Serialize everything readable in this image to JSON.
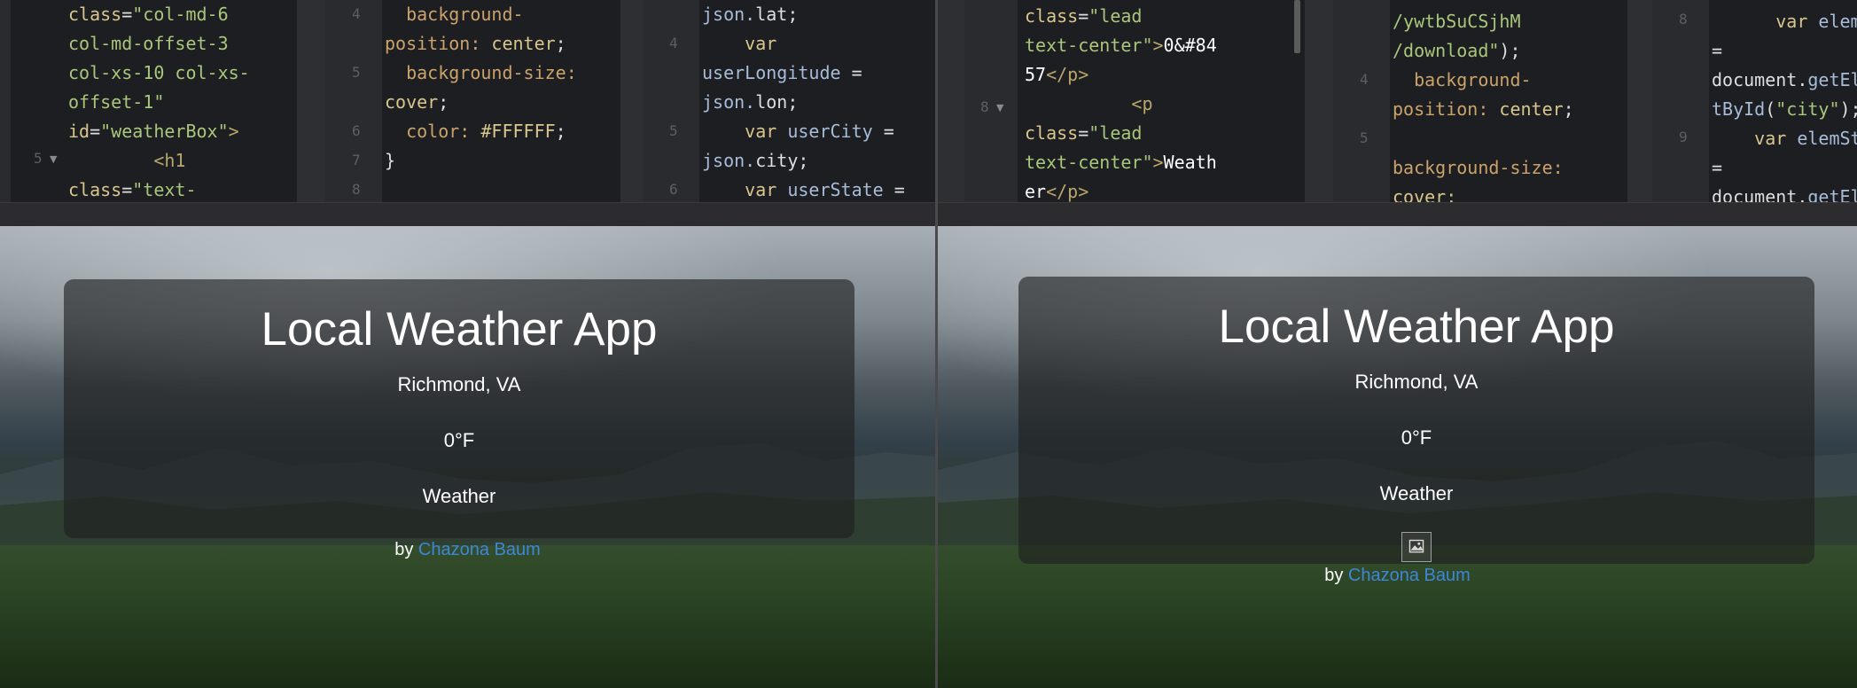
{
  "left": {
    "html_lines": [
      [
        {
          "t": "class",
          "c": "at"
        },
        {
          "t": "=",
          "c": "pl"
        },
        {
          "t": "\"col-md-6",
          "c": "va"
        }
      ],
      [
        {
          "t": "col-md-offset-3",
          "c": "va"
        }
      ],
      [
        {
          "t": "col-xs-10 col-xs-",
          "c": "va"
        }
      ],
      [
        {
          "t": "offset-1\"",
          "c": "va"
        }
      ],
      [
        {
          "t": "id",
          "c": "at"
        },
        {
          "t": "=",
          "c": "pl"
        },
        {
          "t": "\"weatherBox\"",
          "c": "va"
        },
        {
          "t": ">",
          "c": "tg"
        }
      ],
      [
        {
          "t": "        <h1",
          "c": "tg"
        }
      ],
      [
        {
          "t": "class",
          "c": "at"
        },
        {
          "t": "=",
          "c": "pl"
        },
        {
          "t": "\"text-",
          "c": "va"
        }
      ]
    ],
    "html_gutter": [
      {
        "n": "5",
        "row": 5
      }
    ],
    "css_lines": [
      [
        {
          "t": "  background-",
          "c": "ky"
        }
      ],
      [
        {
          "t": "position: ",
          "c": "ky"
        },
        {
          "t": "center",
          "c": "at"
        },
        {
          "t": ";",
          "c": "pl"
        }
      ],
      [
        {
          "t": "  background-size:",
          "c": "ky"
        }
      ],
      [
        {
          "t": "cover",
          "c": "at"
        },
        {
          "t": ";",
          "c": "pl"
        }
      ],
      [
        {
          "t": "  color: ",
          "c": "ky"
        },
        {
          "t": "#FFFFFF",
          "c": "at"
        },
        {
          "t": ";",
          "c": "pl"
        }
      ],
      [
        {
          "t": "}",
          "c": "pl"
        }
      ],
      [
        {
          "t": "",
          "c": "pl"
        }
      ]
    ],
    "css_gutter": [
      {
        "n": "4",
        "row": 0
      },
      {
        "n": "5",
        "row": 2
      },
      {
        "n": "6",
        "row": 4
      },
      {
        "n": "7",
        "row": 5
      },
      {
        "n": "8",
        "row": 6
      }
    ],
    "js_lines": [
      [
        {
          "t": "json.",
          "c": "bl"
        },
        {
          "t": "lat",
          "c": "pl"
        },
        {
          "t": ";",
          "c": "pl"
        }
      ],
      [
        {
          "t": "    var",
          "c": "at"
        }
      ],
      [
        {
          "t": "userLongitude ",
          "c": "bl"
        },
        {
          "t": "=",
          "c": "pl"
        }
      ],
      [
        {
          "t": "json.",
          "c": "bl"
        },
        {
          "t": "lon",
          "c": "pl"
        },
        {
          "t": ";",
          "c": "pl"
        }
      ],
      [
        {
          "t": "    var ",
          "c": "at"
        },
        {
          "t": "userCity ",
          "c": "bl"
        },
        {
          "t": "=",
          "c": "pl"
        }
      ],
      [
        {
          "t": "json.",
          "c": "bl"
        },
        {
          "t": "city",
          "c": "pl"
        },
        {
          "t": ";",
          "c": "pl"
        }
      ],
      [
        {
          "t": "    var ",
          "c": "at"
        },
        {
          "t": "userState ",
          "c": "bl"
        },
        {
          "t": "=",
          "c": "pl"
        }
      ]
    ],
    "js_gutter": [
      {
        "n": "4",
        "row": 1
      },
      {
        "n": "5",
        "row": 4
      },
      {
        "n": "6",
        "row": 6
      }
    ]
  },
  "right": {
    "html_lines": [
      [
        {
          "t": "class",
          "c": "at"
        },
        {
          "t": "=",
          "c": "pl"
        },
        {
          "t": "\"lead",
          "c": "va"
        }
      ],
      [
        {
          "t": "text-center\"",
          "c": "va"
        },
        {
          "t": ">",
          "c": "tg"
        },
        {
          "t": "0&#84",
          "c": "wh"
        }
      ],
      [
        {
          "t": "57",
          "c": "wh"
        },
        {
          "t": "</p>",
          "c": "tg"
        }
      ],
      [
        {
          "t": "          <p",
          "c": "tg"
        }
      ],
      [
        {
          "t": "class",
          "c": "at"
        },
        {
          "t": "=",
          "c": "pl"
        },
        {
          "t": "\"lead",
          "c": "va"
        }
      ],
      [
        {
          "t": "text-center\"",
          "c": "va"
        },
        {
          "t": ">",
          "c": "tg"
        },
        {
          "t": "Weath",
          "c": "wh"
        }
      ],
      [
        {
          "t": "er",
          "c": "wh"
        },
        {
          "t": "</p>",
          "c": "tg"
        }
      ]
    ],
    "html_gutter": [
      {
        "n": "8",
        "row": 3
      }
    ],
    "css_lines": [
      [
        {
          "t": "/ywtbSuCSjhM",
          "c": "va"
        }
      ],
      [
        {
          "t": "/download\"",
          "c": "va"
        },
        {
          "t": ");",
          "c": "pl"
        }
      ],
      [
        {
          "t": "  background-",
          "c": "ky"
        }
      ],
      [
        {
          "t": "position: ",
          "c": "ky"
        },
        {
          "t": "center",
          "c": "at"
        },
        {
          "t": ";",
          "c": "pl"
        }
      ],
      [
        {
          "t": "",
          "c": "pl"
        }
      ],
      [
        {
          "t": "background-size:",
          "c": "ky"
        }
      ],
      [
        {
          "t": "cover;",
          "c": "at"
        }
      ]
    ],
    "css_gutter": [
      {
        "n": "4",
        "row": 2
      },
      {
        "n": "5",
        "row": 4
      }
    ],
    "js_lines": [
      [
        {
          "t": "      var ",
          "c": "at"
        },
        {
          "t": "elemCity",
          "c": "bl"
        }
      ],
      [
        {
          "t": "=",
          "c": "pl"
        }
      ],
      [
        {
          "t": "document.",
          "c": "pl"
        },
        {
          "t": "getEleme",
          "c": "bl"
        }
      ],
      [
        {
          "t": "tById",
          "c": "bl"
        },
        {
          "t": "(",
          "c": "pl"
        },
        {
          "t": "\"city\"",
          "c": "va"
        },
        {
          "t": ");",
          "c": "pl"
        }
      ],
      [
        {
          "t": "    var ",
          "c": "at"
        },
        {
          "t": "elemState",
          "c": "bl"
        }
      ],
      [
        {
          "t": "=",
          "c": "pl"
        }
      ],
      [
        {
          "t": "document.",
          "c": "pl"
        },
        {
          "t": "getEleme",
          "c": "bl"
        }
      ]
    ],
    "js_gutter": [
      {
        "n": "8",
        "row": 0
      },
      {
        "n": "9",
        "row": 4
      }
    ]
  },
  "weather_left": {
    "title": "Local Weather App",
    "location": "Richmond, VA",
    "temperature": "0°F",
    "condition": "Weather",
    "by_prefix": "by ",
    "author": "Chazona Baum"
  },
  "weather_right": {
    "title": "Local Weather App",
    "location": "Richmond, VA",
    "temperature": "0°F",
    "condition": "Weather",
    "by_prefix": "by ",
    "author": "Chazona Baum"
  }
}
